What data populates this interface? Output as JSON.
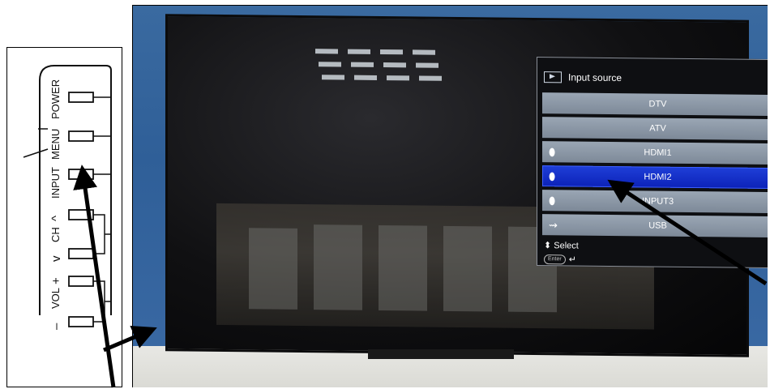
{
  "diagram": {
    "buttons": [
      {
        "label": "POWER"
      },
      {
        "label": "MENU"
      },
      {
        "label": "INPUT"
      },
      {
        "label": "CH"
      },
      {
        "label": "VOL"
      }
    ],
    "symbols": {
      "ch_up": "^",
      "ch_down": "v",
      "vol_plus": "+",
      "vol_minus": "–"
    }
  },
  "tv_menu": {
    "title": "Input source",
    "title_icon": "input-source-icon",
    "items": [
      {
        "label": "DTV",
        "icon": ""
      },
      {
        "label": "ATV",
        "icon": ""
      },
      {
        "label": "HDMI1",
        "icon": "hdmi-icon"
      },
      {
        "label": "HDMI2",
        "icon": "hdmi-icon",
        "selected": true
      },
      {
        "label": "INPUT3",
        "icon": "hdmi-icon"
      },
      {
        "label": "USB",
        "icon": "usb-icon"
      }
    ],
    "footer": {
      "select_label": "Select",
      "enter_label": "Enter"
    },
    "colors": {
      "selected_bg": "#1530c8",
      "item_bg": "#8d98a6",
      "menu_bg": "#0e0f12"
    }
  }
}
